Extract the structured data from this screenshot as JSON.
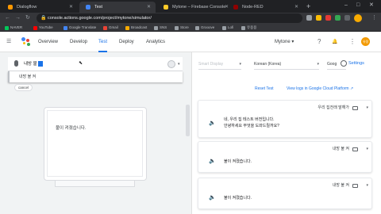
{
  "browser": {
    "tabs": [
      {
        "title": "Dialogflow",
        "fav": "#ff9800"
      },
      {
        "title": "Test",
        "fav": "#4285f4"
      },
      {
        "title": "Mytone – Firebase Console",
        "fav": "#ffca28"
      },
      {
        "title": "Node-RED",
        "fav": "#8f0000"
      }
    ],
    "new_tab_icon": "+",
    "window_controls": [
      "–",
      "□",
      "✕"
    ],
    "url": "console.actions.google.com/project/mytone/simulator/",
    "bookmarks": [
      "NAVER",
      "YouTube",
      "Google Translate",
      "Gmail",
      "Broadcast",
      "SNS",
      "Store",
      "Grooove",
      "Lofi",
      "유용용"
    ],
    "bookmark_colors": [
      "#03c75a",
      "#ff0000",
      "#4285f4",
      "#ea4335",
      "#f9ab00",
      "#9aa0a6",
      "#9aa0a6",
      "#9aa0a6",
      "#9aa0a6",
      "#9aa0a6"
    ]
  },
  "app": {
    "nav": [
      "Overview",
      "Develop",
      "Test",
      "Deploy",
      "Analytics"
    ],
    "active_nav": "Test",
    "project": "Mytone",
    "project_arrow": "▾",
    "help_icon": "?",
    "bell_icon": "🔔",
    "menu_icon": "⋮",
    "avatar_text": "유정"
  },
  "simulator": {
    "query": "내방 불",
    "suggestion": "내방 불 켜",
    "cancel_chip": "cancel",
    "display_text": "불이 켜졌습니다.",
    "caret_down": "▾"
  },
  "right": {
    "surface_select": "Smart Display",
    "language_select": "Korean (Korea)",
    "location_select": "Goog",
    "settings_link": "Settings",
    "reset_link": "Reset Test",
    "view_logs_link": "View logs in Google Cloud Platform",
    "conversation": [
      {
        "user": "우리 집전래 말해가",
        "response": [
          "네, 우리 집 테스트 버전입니다.",
          "안녕하세요 무엇을 도와드릴까요?"
        ]
      },
      {
        "user": "내방 불 켜",
        "response": [
          "불이 켜졌습니다."
        ]
      },
      {
        "user": "내방 불 켜",
        "response": [
          "불이 켜졌습니다."
        ]
      }
    ]
  }
}
